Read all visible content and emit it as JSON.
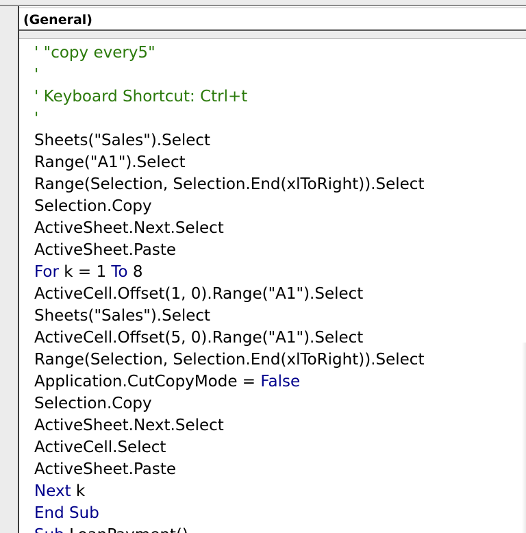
{
  "object_dropdown": {
    "label": "(General)"
  },
  "code_lines": [
    [
      {
        "t": "' \"copy every5\"",
        "k": "comment"
      }
    ],
    [
      {
        "t": "'",
        "k": "comment"
      }
    ],
    [
      {
        "t": "' Keyboard Shortcut: Ctrl+t",
        "k": "comment"
      }
    ],
    [
      {
        "t": "'",
        "k": "comment"
      }
    ],
    [
      {
        "t": "Sheets(\"Sales\").Select",
        "k": "plain"
      }
    ],
    [
      {
        "t": "Range(\"A1\").Select",
        "k": "plain"
      }
    ],
    [
      {
        "t": "Range(Selection, Selection.End(xlToRight)).Select",
        "k": "plain"
      }
    ],
    [
      {
        "t": "Selection.Copy",
        "k": "plain"
      }
    ],
    [
      {
        "t": "ActiveSheet.Next.Select",
        "k": "plain"
      }
    ],
    [
      {
        "t": "ActiveSheet.Paste",
        "k": "plain"
      }
    ],
    [
      {
        "t": "For",
        "k": "kw"
      },
      {
        "t": " k = 1 ",
        "k": "plain"
      },
      {
        "t": "To",
        "k": "kw"
      },
      {
        "t": " 8",
        "k": "plain"
      }
    ],
    [
      {
        "t": "ActiveCell.Offset(1, 0).Range(\"A1\").Select",
        "k": "plain"
      }
    ],
    [
      {
        "t": "Sheets(\"Sales\").Select",
        "k": "plain"
      }
    ],
    [
      {
        "t": "ActiveCell.Offset(5, 0).Range(\"A1\").Select",
        "k": "plain"
      }
    ],
    [
      {
        "t": "Range(Selection, Selection.End(xlToRight)).Select",
        "k": "plain"
      }
    ],
    [
      {
        "t": "Application.CutCopyMode = ",
        "k": "plain"
      },
      {
        "t": "False",
        "k": "kw"
      }
    ],
    [
      {
        "t": "Selection.Copy",
        "k": "plain"
      }
    ],
    [
      {
        "t": "ActiveSheet.Next.Select",
        "k": "plain"
      }
    ],
    [
      {
        "t": "ActiveCell.Select",
        "k": "plain"
      }
    ],
    [
      {
        "t": "ActiveSheet.Paste",
        "k": "plain"
      }
    ],
    [
      {
        "t": "Next",
        "k": "kw"
      },
      {
        "t": " k",
        "k": "plain"
      }
    ],
    [
      {
        "t": "End Sub",
        "k": "kw"
      }
    ],
    [
      {
        "t": "Sub",
        "k": "kw"
      },
      {
        "t": " LoanPayment()",
        "k": "plain"
      }
    ]
  ],
  "colors": {
    "comment": "#2b7a0b",
    "keyword": "#00008b",
    "text": "#000000"
  }
}
